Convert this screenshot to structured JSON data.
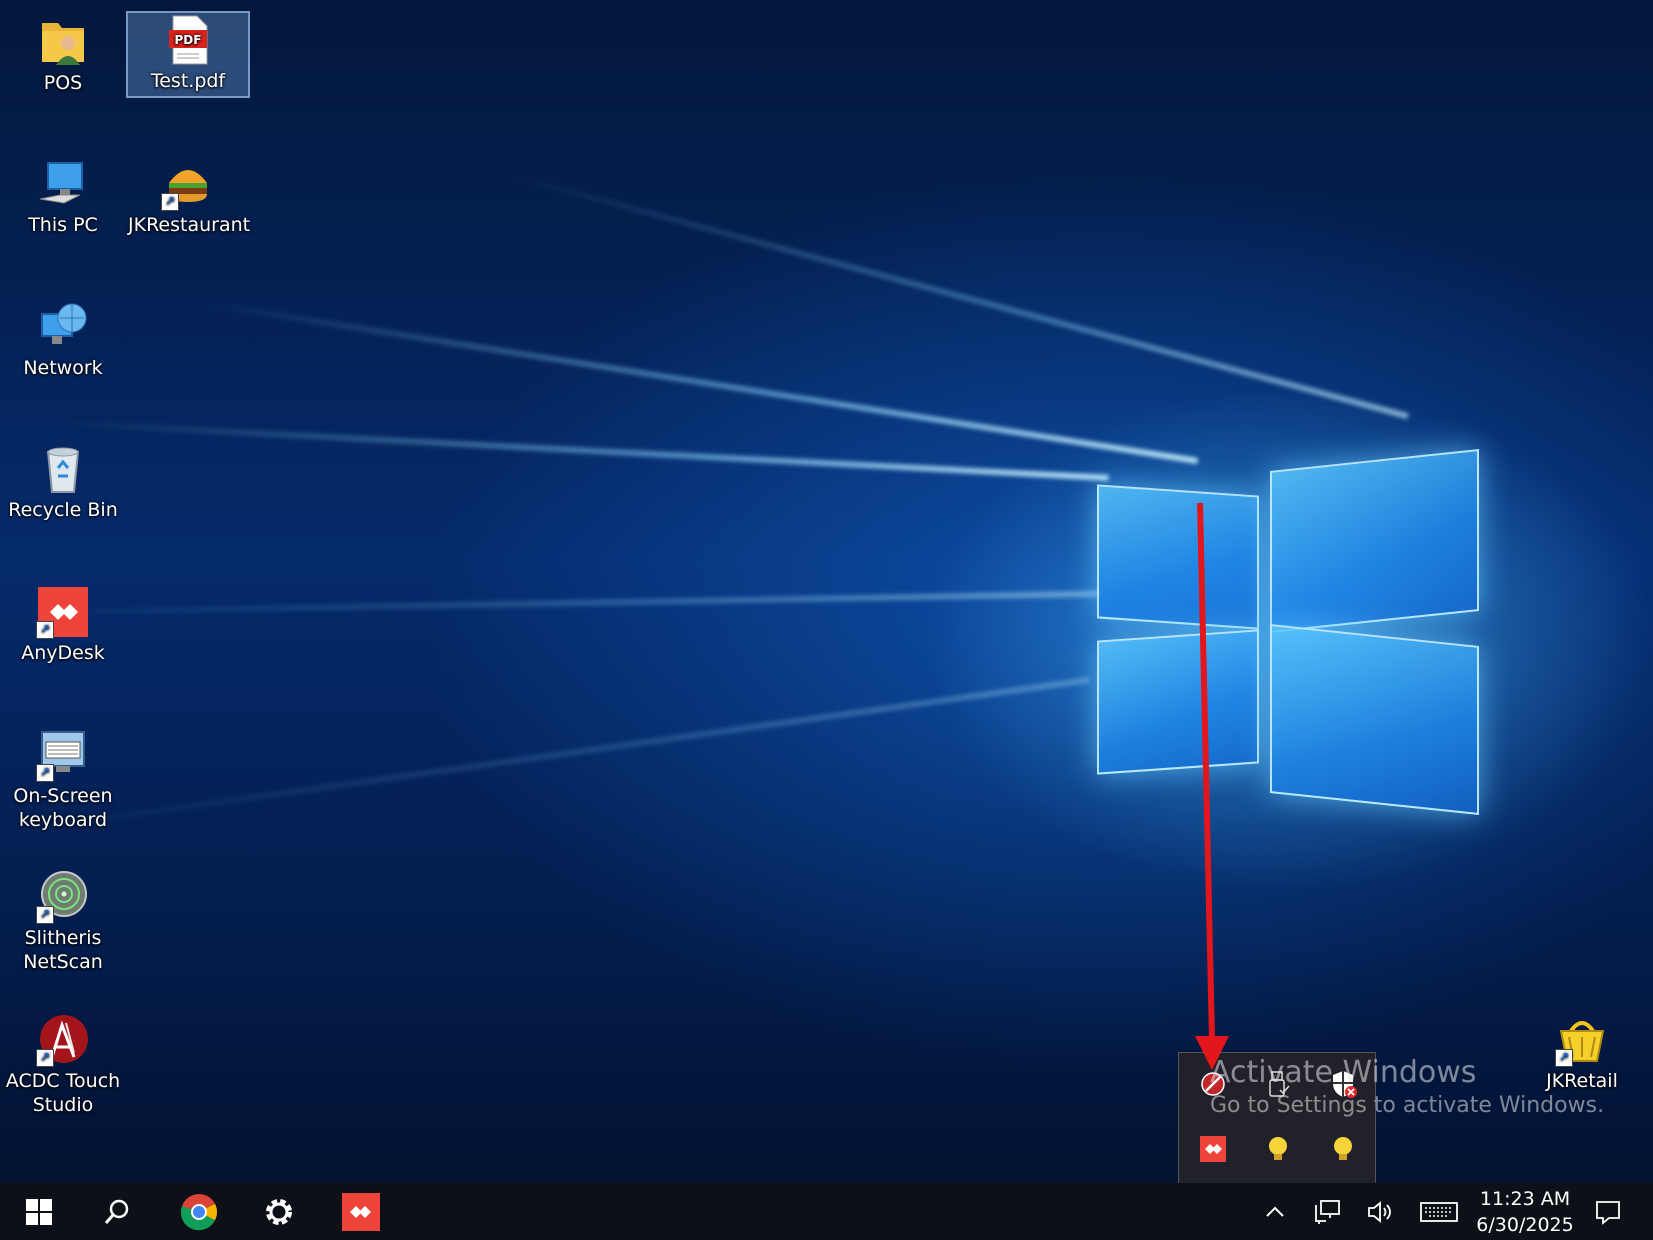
{
  "desktop": {
    "icons": [
      {
        "label": "POS",
        "icon": "folder-user-icon"
      },
      {
        "label": "Test.pdf",
        "icon": "pdf-file-icon",
        "selected": true
      },
      {
        "label": "This PC",
        "icon": "computer-icon"
      },
      {
        "label": "JKRestaurant",
        "icon": "burger-icon"
      },
      {
        "label": "Network",
        "icon": "network-globe-icon"
      },
      {
        "label": "Recycle Bin",
        "icon": "recycle-bin-icon"
      },
      {
        "label": "AnyDesk",
        "icon": "anydesk-icon"
      },
      {
        "label": "On-Screen keyboard",
        "icon": "keyboard-icon"
      },
      {
        "label": "Slitheris NetScan",
        "icon": "radar-icon"
      },
      {
        "label": "ACDC Touch Studio",
        "icon": "acdc-icon"
      },
      {
        "label": "JKRetail",
        "icon": "shopping-basket-icon"
      }
    ],
    "pdf_badge": "PDF"
  },
  "tray_popup": {
    "icons": [
      "no-signal-icon",
      "usb-device-icon",
      "security-shield-icon",
      "anydesk-icon",
      "bulb-icon",
      "bulb-icon"
    ]
  },
  "watermark": {
    "title": "Activate Windows",
    "subtitle": "Go to Settings to activate Windows."
  },
  "taskbar": {
    "pinned": [
      "windows-start-icon",
      "search-icon",
      "chrome-icon",
      "gear-icon",
      "anydesk-icon"
    ],
    "tray": [
      "chevron-up-icon",
      "network-icon",
      "volume-icon",
      "keyboard-icon",
      "notification-icon"
    ],
    "time": "11:23 AM",
    "date": "6/30/2025"
  },
  "annotation": {
    "color": "#e3161b"
  }
}
